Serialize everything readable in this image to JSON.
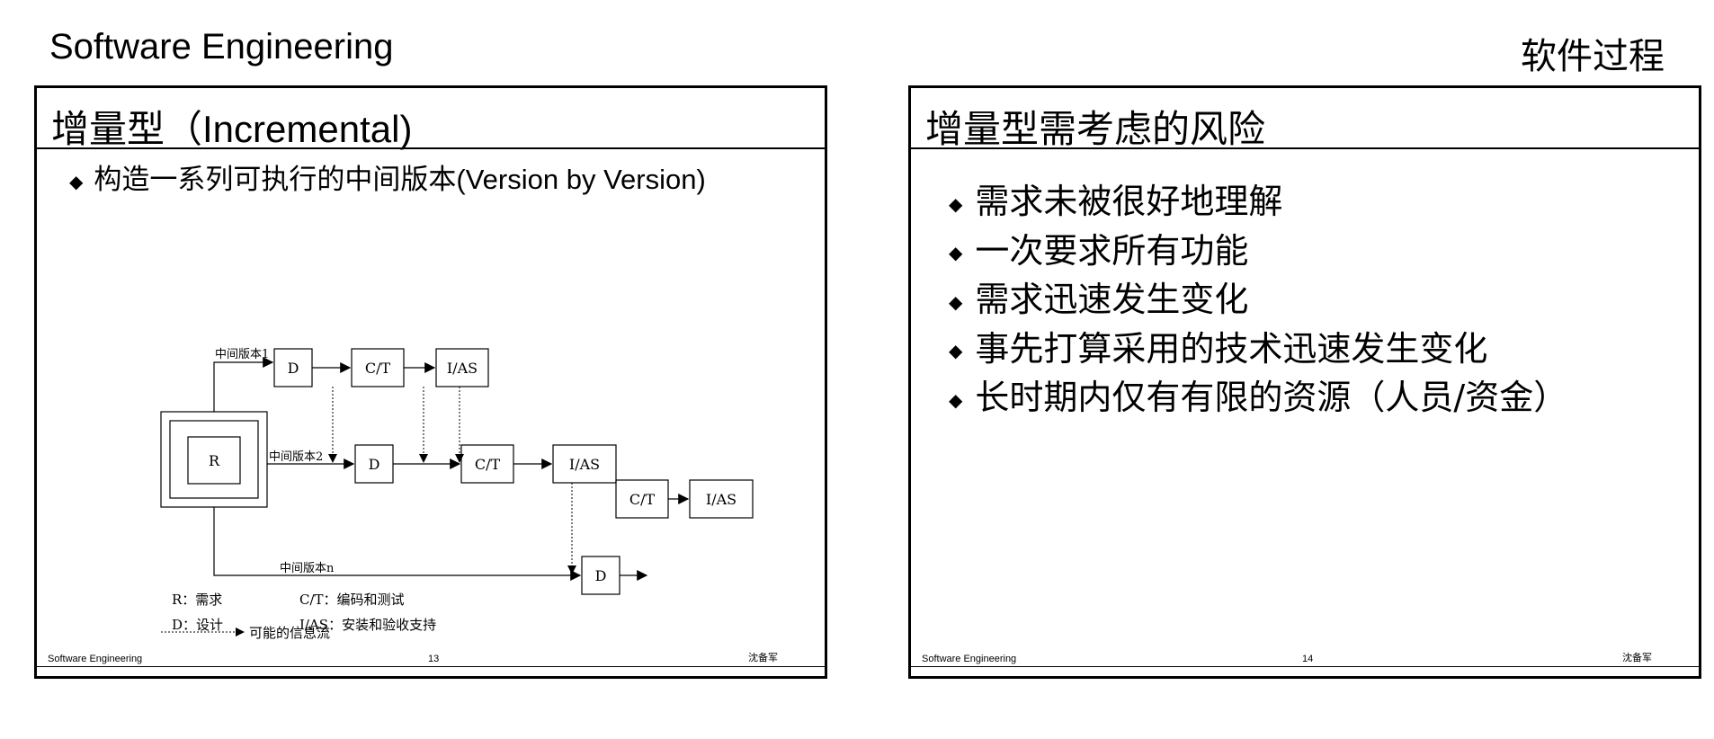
{
  "header": {
    "left": "Software Engineering",
    "right": "软件过程"
  },
  "slide1": {
    "title_cn": "增量型（",
    "title_en": "Incremental)",
    "bullet_cn": "构造一系列可执行的中间版本",
    "bullet_en": "(Version by Version)",
    "diagram": {
      "v1_label": "中间版本1",
      "v2_label": "中间版本2",
      "vn_label": "中间版本n",
      "box_r": "R",
      "box_d": "D",
      "box_ct": "C/T",
      "box_ias": "I/AS",
      "legend_flow": "可能的信息流",
      "legend_r": "R：需求",
      "legend_ct": "C/T：编码和测试",
      "legend_d": "D：设计",
      "legend_ias": "I/AS：安装和验收支持"
    },
    "footer": {
      "left": "Software Engineering",
      "page": "13",
      "author": "沈备军"
    }
  },
  "slide2": {
    "title": "增量型需考虑的风险",
    "items": [
      "需求未被很好地理解",
      "一次要求所有功能",
      "需求迅速发生变化",
      "事先打算采用的技术迅速发生变化",
      "长时期内仅有有限的资源（人员/资金）"
    ],
    "footer": {
      "left": "Software Engineering",
      "page": "14",
      "author": "沈备军"
    }
  }
}
